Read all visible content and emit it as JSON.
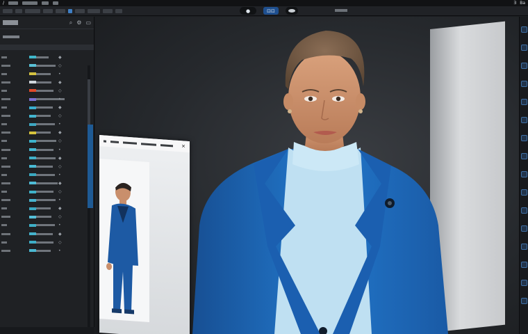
{
  "app": {
    "menu_left_glyph": "/",
    "menu_items": [
      "",
      "",
      "",
      "",
      ""
    ],
    "menu_right": [
      "Ǝ",
      "Ba"
    ],
    "toolbar_center": {
      "pill_glyph": "● ",
      "blue_button_label": "⊡⊡"
    }
  },
  "left_panel": {
    "header_icons": [
      "search-icon",
      "settings-icon",
      "camera-icon"
    ],
    "rows": [
      {
        "swatch": "#3fb6c9"
      },
      {
        "swatch": "#59c0d6"
      },
      {
        "swatch": "#d4c240"
      },
      {
        "swatch": "#d0d6dc"
      },
      {
        "swatch": "#e04a2a"
      },
      {
        "swatch": "#7b6fd1"
      },
      {
        "swatch": "#3aaed0"
      },
      {
        "swatch": "#43b6d1"
      },
      {
        "swatch": "#3ea7c2"
      },
      {
        "swatch": "#d6c43c"
      },
      {
        "swatch": "#3cb2cc"
      },
      {
        "swatch": "#45b8d2"
      },
      {
        "swatch": "#3fb0c8"
      },
      {
        "swatch": "#49bad4"
      },
      {
        "swatch": "#3aa9c1"
      },
      {
        "swatch": "#4fbcd6"
      },
      {
        "swatch": "#3fb2c9"
      },
      {
        "swatch": "#48b4cf"
      },
      {
        "swatch": "#3ba9c3"
      },
      {
        "swatch": "#55bfd8"
      },
      {
        "swatch": "#3fb0c8"
      },
      {
        "swatch": "#44b3cd"
      },
      {
        "swatch": "#3eaec7"
      },
      {
        "swatch": "#4ab8d1"
      }
    ]
  },
  "right_toolbar": {
    "buttons": 16,
    "accent": "#3e6fa5"
  },
  "colors": {
    "accent_blue": "#1e5a94",
    "jacket_blue": "#1f6fc0",
    "turtleneck": "#bfe0f2"
  }
}
